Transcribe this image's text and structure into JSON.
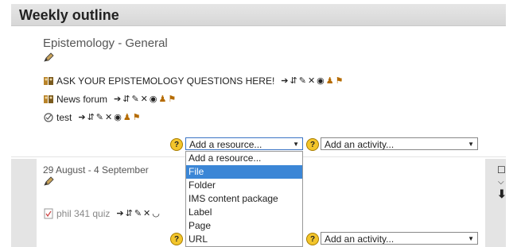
{
  "header": {
    "title": "Weekly outline"
  },
  "section1": {
    "title": "Epistemology - General",
    "activities": [
      {
        "label": "ASK YOUR EPISTEMOLOGY QUESTIONS HERE!",
        "icon": "forum-icon"
      },
      {
        "label": "News forum",
        "icon": "forum-icon"
      },
      {
        "label": "test",
        "icon": "quiz-icon"
      }
    ],
    "add_resource": "Add a resource...",
    "add_activity": "Add an activity..."
  },
  "section2": {
    "date": "29 August - 4 September",
    "activities": [
      {
        "label": "phil 341 quiz",
        "icon": "quiz-icon"
      }
    ],
    "add_activity": "Add an activity..."
  },
  "dropdown": {
    "options": [
      "Add a resource...",
      "File",
      "Folder",
      "IMS content package",
      "Label",
      "Page",
      "URL"
    ],
    "selected": "File"
  },
  "help_glyph": "?",
  "colors": {
    "highlight": "#3b86d6",
    "help": "#f3c52b",
    "section_gutter": "#e4e4e4"
  }
}
